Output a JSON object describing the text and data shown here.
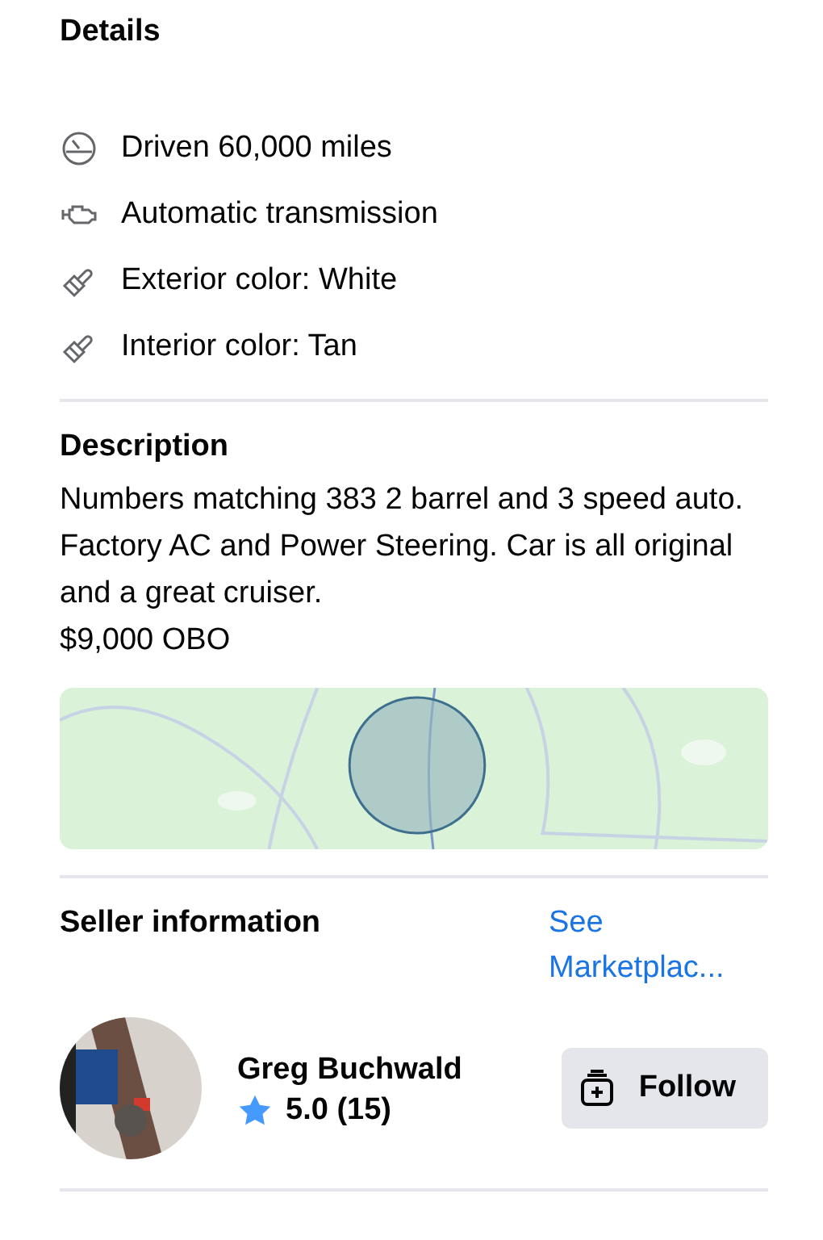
{
  "details": {
    "title": "Details",
    "items": [
      {
        "kind": "mileage",
        "text": "Driven 60,000 miles"
      },
      {
        "kind": "engine",
        "text": "Automatic transmission"
      },
      {
        "kind": "paint",
        "text": "Exterior color: White"
      },
      {
        "kind": "paint",
        "text": "Interior color: Tan"
      }
    ]
  },
  "description": {
    "title": "Description",
    "lines": [
      "Numbers matching 383 2 barrel and 3 speed auto. Factory AC and Power Steering. Car is all original and a great cruiser.",
      "$9,000 OBO"
    ]
  },
  "seller": {
    "title": "Seller information",
    "link": "See Marketplac...",
    "name": "Greg Buchwald",
    "rating": "5.0 (15)",
    "follow_button": "Follow"
  }
}
